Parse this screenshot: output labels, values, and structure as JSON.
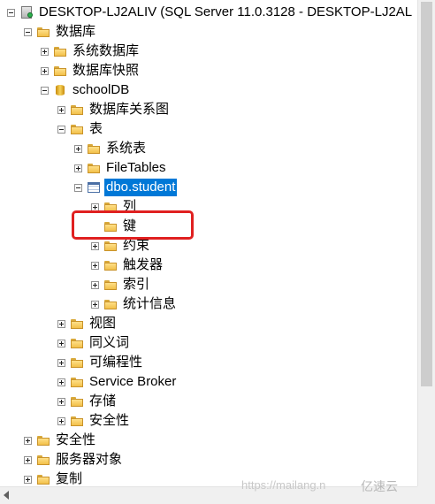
{
  "tree": {
    "server": "DESKTOP-LJ2ALIV (SQL Server 11.0.3128 - DESKTOP-LJ2AL",
    "databases": "数据库",
    "system_databases": "系统数据库",
    "db_snapshots": "数据库快照",
    "schooldb": "schoolDB",
    "db_diagrams": "数据库关系图",
    "tables": "表",
    "system_tables": "系统表",
    "filetables": "FileTables",
    "student": "dbo.student",
    "columns": "列",
    "keys": "键",
    "constraints": "约束",
    "triggers": "触发器",
    "indexes": "索引",
    "statistics": "统计信息",
    "views": "视图",
    "synonyms": "同义词",
    "programmability": "可编程性",
    "service_broker": "Service Broker",
    "storage": "存储",
    "security_db": "安全性",
    "security": "安全性",
    "server_objects": "服务器对象",
    "replication": "复制"
  },
  "watermark": {
    "url": "https://mailang.n",
    "brand": "亿速云"
  }
}
